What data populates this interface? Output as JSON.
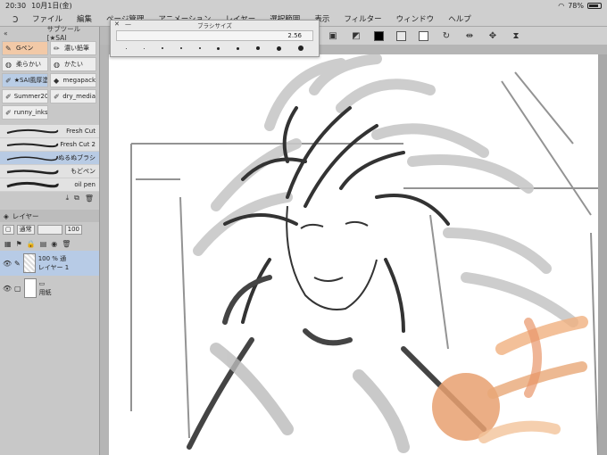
{
  "status": {
    "time": "20:30",
    "date": "10月1日(金)",
    "battery": "78%"
  },
  "menu": [
    "ファイル",
    "編集",
    "ページ管理",
    "アニメーション",
    "レイヤー",
    "選択範囲",
    "表示",
    "フィルター",
    "ウィンドウ",
    "ヘルプ"
  ],
  "brush_popup": {
    "title": "ブラシサイズ",
    "value": "2.56"
  },
  "subtool_header": "サブツール[★SAI",
  "subtools": [
    {
      "label": "Gペン",
      "icon": "pen-icon",
      "state": "active"
    },
    {
      "label": "濃い鉛筆",
      "icon": "pencil-icon",
      "state": ""
    },
    {
      "label": "柔らかい",
      "icon": "airbrush-icon",
      "state": ""
    },
    {
      "label": "かたい",
      "icon": "airbrush-icon",
      "state": ""
    },
    {
      "label": "★SAI風厚塗",
      "icon": "brush-icon",
      "state": "sel"
    },
    {
      "label": "megapack",
      "icon": "brush-icon",
      "state": ""
    },
    {
      "label": "Summer20",
      "icon": "brush-icon",
      "state": ""
    },
    {
      "label": "dry_media",
      "icon": "brush-icon",
      "state": ""
    },
    {
      "label": "runny_inks",
      "icon": "brush-icon",
      "state": ""
    }
  ],
  "brushes": [
    {
      "label": "Fresh Cut",
      "sel": false
    },
    {
      "label": "Fresh Cut 2",
      "sel": false
    },
    {
      "label": "ぬるぬブラシ",
      "sel": true
    },
    {
      "label": "もどペン",
      "sel": false
    },
    {
      "label": "oil pen",
      "sel": false
    }
  ],
  "layer_panel": {
    "title": "レイヤー",
    "blend": "通常",
    "opacity": "100",
    "layers": [
      {
        "opacity": "100 % 通",
        "name": "レイヤー 1",
        "sel": true
      },
      {
        "opacity": "",
        "name": "用紙",
        "sel": false
      }
    ]
  }
}
